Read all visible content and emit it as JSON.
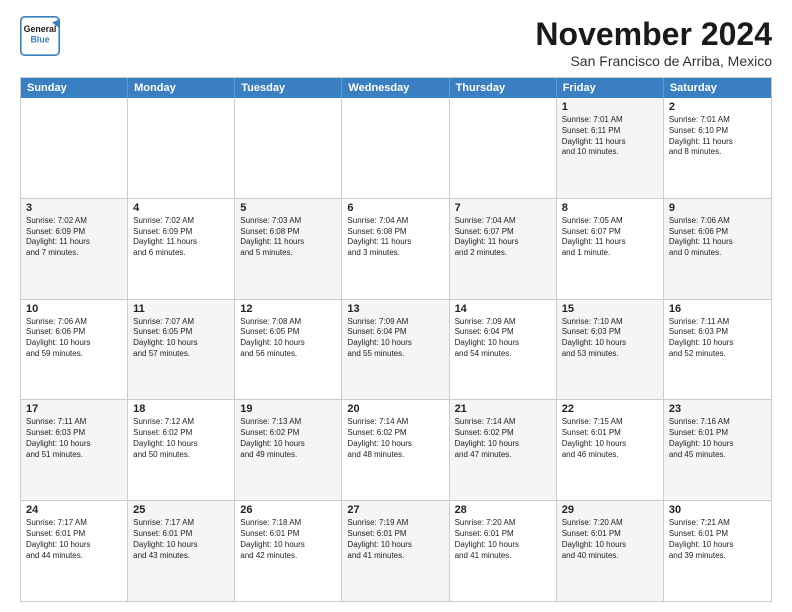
{
  "logo": {
    "line1": "General",
    "line2": "Blue"
  },
  "title": "November 2024",
  "location": "San Francisco de Arriba, Mexico",
  "weekdays": [
    "Sunday",
    "Monday",
    "Tuesday",
    "Wednesday",
    "Thursday",
    "Friday",
    "Saturday"
  ],
  "rows": [
    [
      {
        "day": "",
        "info": "",
        "empty": true
      },
      {
        "day": "",
        "info": "",
        "empty": true
      },
      {
        "day": "",
        "info": "",
        "empty": true
      },
      {
        "day": "",
        "info": "",
        "empty": true
      },
      {
        "day": "",
        "info": "",
        "empty": true
      },
      {
        "day": "1",
        "info": "Sunrise: 7:01 AM\nSunset: 6:11 PM\nDaylight: 11 hours\nand 10 minutes.",
        "empty": false,
        "shaded": true
      },
      {
        "day": "2",
        "info": "Sunrise: 7:01 AM\nSunset: 6:10 PM\nDaylight: 11 hours\nand 8 minutes.",
        "empty": false,
        "shaded": false
      }
    ],
    [
      {
        "day": "3",
        "info": "Sunrise: 7:02 AM\nSunset: 6:09 PM\nDaylight: 11 hours\nand 7 minutes.",
        "empty": false,
        "shaded": true
      },
      {
        "day": "4",
        "info": "Sunrise: 7:02 AM\nSunset: 6:09 PM\nDaylight: 11 hours\nand 6 minutes.",
        "empty": false,
        "shaded": false
      },
      {
        "day": "5",
        "info": "Sunrise: 7:03 AM\nSunset: 6:08 PM\nDaylight: 11 hours\nand 5 minutes.",
        "empty": false,
        "shaded": true
      },
      {
        "day": "6",
        "info": "Sunrise: 7:04 AM\nSunset: 6:08 PM\nDaylight: 11 hours\nand 3 minutes.",
        "empty": false,
        "shaded": false
      },
      {
        "day": "7",
        "info": "Sunrise: 7:04 AM\nSunset: 6:07 PM\nDaylight: 11 hours\nand 2 minutes.",
        "empty": false,
        "shaded": true
      },
      {
        "day": "8",
        "info": "Sunrise: 7:05 AM\nSunset: 6:07 PM\nDaylight: 11 hours\nand 1 minute.",
        "empty": false,
        "shaded": false
      },
      {
        "day": "9",
        "info": "Sunrise: 7:06 AM\nSunset: 6:06 PM\nDaylight: 11 hours\nand 0 minutes.",
        "empty": false,
        "shaded": true
      }
    ],
    [
      {
        "day": "10",
        "info": "Sunrise: 7:06 AM\nSunset: 6:06 PM\nDaylight: 10 hours\nand 59 minutes.",
        "empty": false,
        "shaded": false
      },
      {
        "day": "11",
        "info": "Sunrise: 7:07 AM\nSunset: 6:05 PM\nDaylight: 10 hours\nand 57 minutes.",
        "empty": false,
        "shaded": true
      },
      {
        "day": "12",
        "info": "Sunrise: 7:08 AM\nSunset: 6:05 PM\nDaylight: 10 hours\nand 56 minutes.",
        "empty": false,
        "shaded": false
      },
      {
        "day": "13",
        "info": "Sunrise: 7:09 AM\nSunset: 6:04 PM\nDaylight: 10 hours\nand 55 minutes.",
        "empty": false,
        "shaded": true
      },
      {
        "day": "14",
        "info": "Sunrise: 7:09 AM\nSunset: 6:04 PM\nDaylight: 10 hours\nand 54 minutes.",
        "empty": false,
        "shaded": false
      },
      {
        "day": "15",
        "info": "Sunrise: 7:10 AM\nSunset: 6:03 PM\nDaylight: 10 hours\nand 53 minutes.",
        "empty": false,
        "shaded": true
      },
      {
        "day": "16",
        "info": "Sunrise: 7:11 AM\nSunset: 6:03 PM\nDaylight: 10 hours\nand 52 minutes.",
        "empty": false,
        "shaded": false
      }
    ],
    [
      {
        "day": "17",
        "info": "Sunrise: 7:11 AM\nSunset: 6:03 PM\nDaylight: 10 hours\nand 51 minutes.",
        "empty": false,
        "shaded": true
      },
      {
        "day": "18",
        "info": "Sunrise: 7:12 AM\nSunset: 6:02 PM\nDaylight: 10 hours\nand 50 minutes.",
        "empty": false,
        "shaded": false
      },
      {
        "day": "19",
        "info": "Sunrise: 7:13 AM\nSunset: 6:02 PM\nDaylight: 10 hours\nand 49 minutes.",
        "empty": false,
        "shaded": true
      },
      {
        "day": "20",
        "info": "Sunrise: 7:14 AM\nSunset: 6:02 PM\nDaylight: 10 hours\nand 48 minutes.",
        "empty": false,
        "shaded": false
      },
      {
        "day": "21",
        "info": "Sunrise: 7:14 AM\nSunset: 6:02 PM\nDaylight: 10 hours\nand 47 minutes.",
        "empty": false,
        "shaded": true
      },
      {
        "day": "22",
        "info": "Sunrise: 7:15 AM\nSunset: 6:01 PM\nDaylight: 10 hours\nand 46 minutes.",
        "empty": false,
        "shaded": false
      },
      {
        "day": "23",
        "info": "Sunrise: 7:16 AM\nSunset: 6:01 PM\nDaylight: 10 hours\nand 45 minutes.",
        "empty": false,
        "shaded": true
      }
    ],
    [
      {
        "day": "24",
        "info": "Sunrise: 7:17 AM\nSunset: 6:01 PM\nDaylight: 10 hours\nand 44 minutes.",
        "empty": false,
        "shaded": false
      },
      {
        "day": "25",
        "info": "Sunrise: 7:17 AM\nSunset: 6:01 PM\nDaylight: 10 hours\nand 43 minutes.",
        "empty": false,
        "shaded": true
      },
      {
        "day": "26",
        "info": "Sunrise: 7:18 AM\nSunset: 6:01 PM\nDaylight: 10 hours\nand 42 minutes.",
        "empty": false,
        "shaded": false
      },
      {
        "day": "27",
        "info": "Sunrise: 7:19 AM\nSunset: 6:01 PM\nDaylight: 10 hours\nand 41 minutes.",
        "empty": false,
        "shaded": true
      },
      {
        "day": "28",
        "info": "Sunrise: 7:20 AM\nSunset: 6:01 PM\nDaylight: 10 hours\nand 41 minutes.",
        "empty": false,
        "shaded": false
      },
      {
        "day": "29",
        "info": "Sunrise: 7:20 AM\nSunset: 6:01 PM\nDaylight: 10 hours\nand 40 minutes.",
        "empty": false,
        "shaded": true
      },
      {
        "day": "30",
        "info": "Sunrise: 7:21 AM\nSunset: 6:01 PM\nDaylight: 10 hours\nand 39 minutes.",
        "empty": false,
        "shaded": false
      }
    ]
  ]
}
